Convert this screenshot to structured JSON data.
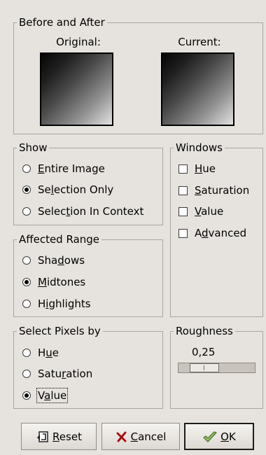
{
  "before_after": {
    "title": "Before and After",
    "original_label": "Original:",
    "current_label": "Current:"
  },
  "show": {
    "title": "Show",
    "options": [
      {
        "label_pre": "",
        "mnemonic": "E",
        "label_post": "ntire Image",
        "checked": false
      },
      {
        "label_pre": "Se",
        "mnemonic": "l",
        "label_post": "ection Only",
        "checked": true
      },
      {
        "label_pre": "Selec",
        "mnemonic": "t",
        "label_post": "ion In Context",
        "checked": false
      }
    ]
  },
  "windows": {
    "title": "Windows",
    "items": [
      {
        "label_pre": "",
        "mnemonic": "H",
        "label_post": "ue",
        "checked": false
      },
      {
        "label_pre": "",
        "mnemonic": "S",
        "label_post": "aturation",
        "checked": false
      },
      {
        "label_pre": "",
        "mnemonic": "V",
        "label_post": "alue",
        "checked": false
      },
      {
        "label_pre": "A",
        "mnemonic": "d",
        "label_post": "vanced",
        "checked": false
      }
    ]
  },
  "affected_range": {
    "title": "Affected Range",
    "options": [
      {
        "label_pre": "Sha",
        "mnemonic": "d",
        "label_post": "ows",
        "checked": false
      },
      {
        "label_pre": "",
        "mnemonic": "M",
        "label_post": "idtones",
        "checked": true
      },
      {
        "label_pre": "H",
        "mnemonic": "i",
        "label_post": "ghlights",
        "checked": false
      }
    ]
  },
  "select_pixels": {
    "title": "Select Pixels by",
    "options": [
      {
        "label_pre": "H",
        "mnemonic": "u",
        "label_post": "e",
        "checked": false
      },
      {
        "label_pre": "Satu",
        "mnemonic": "r",
        "label_post": "ation",
        "checked": false
      },
      {
        "label_pre": "V",
        "mnemonic": "a",
        "label_post": "lue",
        "checked": true
      }
    ]
  },
  "roughness": {
    "title": "Roughness",
    "value_text": "0,25",
    "value": 0.25
  },
  "buttons": {
    "reset": {
      "pre": "",
      "mnemonic": "R",
      "post": "eset"
    },
    "cancel": {
      "pre": "",
      "mnemonic": "C",
      "post": "ancel"
    },
    "ok": {
      "pre": "",
      "mnemonic": "O",
      "post": "K"
    }
  },
  "colors": {
    "background": "#e6e3de",
    "frame_border": "#a9a59e",
    "cancel_x": "#c41515",
    "ok_check": "#4e7a2e"
  },
  "icons": {
    "reset": "reset-icon",
    "cancel": "cancel-x-icon",
    "ok": "ok-check-icon"
  }
}
